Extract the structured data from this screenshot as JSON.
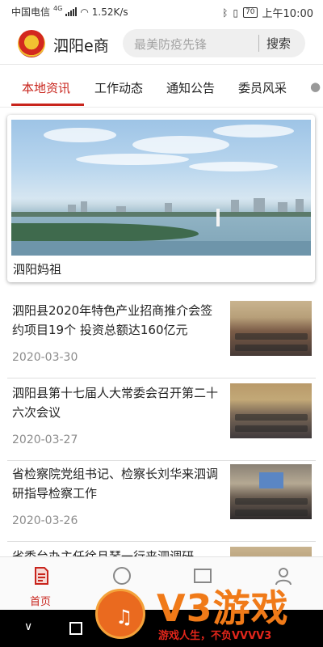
{
  "status_bar": {
    "carrier": "中国电信",
    "network": "4G",
    "speed": "1.52K/s",
    "battery": "70",
    "time": "上午10:00"
  },
  "header": {
    "app_title": "泗阳e商",
    "search_placeholder": "最美防疫先锋",
    "search_button": "搜索",
    "logo_icon": "party-emblem-icon"
  },
  "tabs": [
    {
      "label": "本地资讯",
      "active": true
    },
    {
      "label": "工作动态",
      "active": false
    },
    {
      "label": "通知公告",
      "active": false
    },
    {
      "label": "委员风采",
      "active": false
    }
  ],
  "feature": {
    "caption": "泗阳妈祖"
  },
  "news": [
    {
      "title": "泗阳县2020年特色产业招商推介会签约项目19个 投资总额达160亿元",
      "date": "2020-03-30"
    },
    {
      "title": "泗阳县第十七届人大常委会召开第二十六次会议",
      "date": "2020-03-27"
    },
    {
      "title": "省检察院党组书记、检察长刘华来泗调研指导检察工作",
      "date": "2020-03-26"
    },
    {
      "title": "省委台办主任徐旦琴一行来泗调研",
      "date": ""
    }
  ],
  "bottom_nav": {
    "home_label": "首页"
  },
  "watermark": {
    "brand": "V3游戏",
    "tagline": "游戏人生，不负VVVV3"
  },
  "colors": {
    "accent": "#c8241c",
    "watermark_orange": "#f07a18"
  }
}
